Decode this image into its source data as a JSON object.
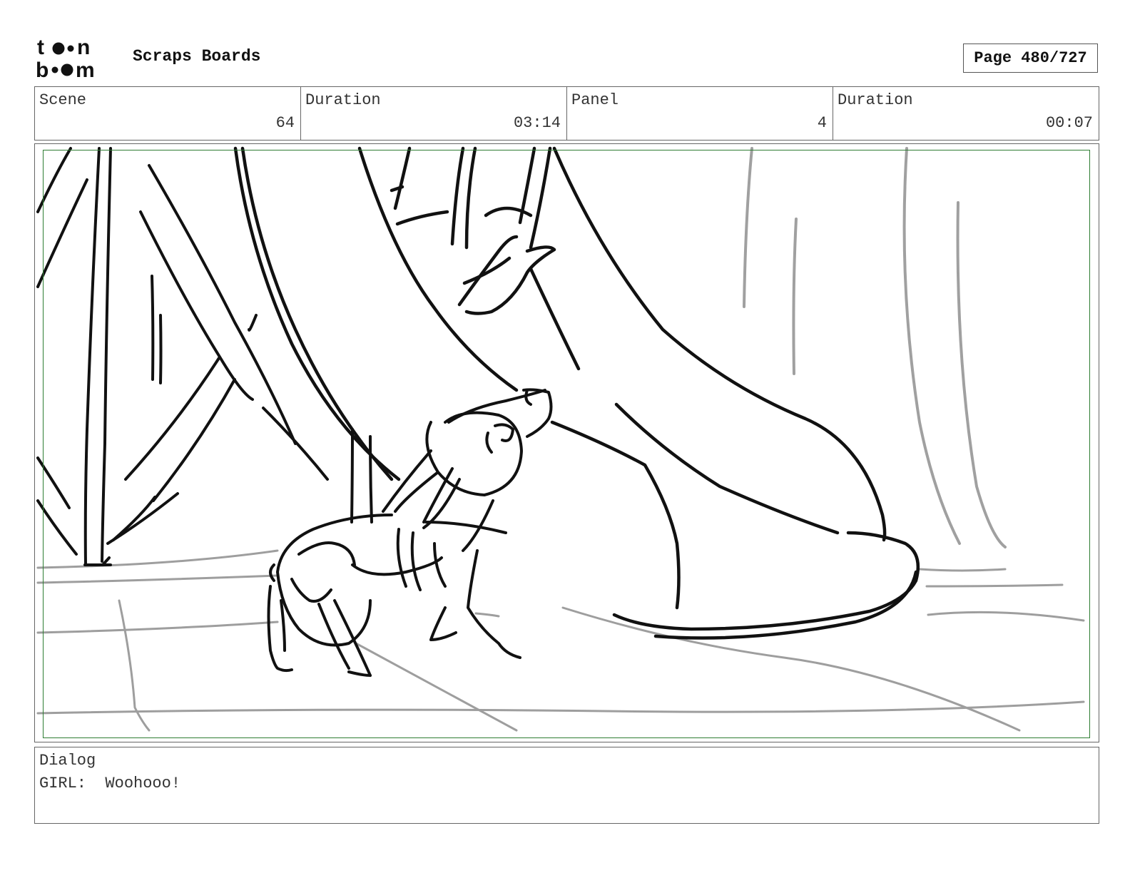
{
  "header": {
    "logo_text": "toon boom",
    "title": "Scraps Boards",
    "page_label": "Page 480/727"
  },
  "info": [
    {
      "label": "Scene",
      "value": "64"
    },
    {
      "label": "Duration",
      "value": "03:14"
    },
    {
      "label": "Panel",
      "value": "4"
    },
    {
      "label": "Duration",
      "value": "00:07"
    }
  ],
  "panel": {
    "image_subject": "sketch of a small dog stretching beside a large shoe on a tiled floor"
  },
  "dialog": {
    "label": "Dialog",
    "speaker": "GIRL:",
    "line": "Woohooo!"
  }
}
